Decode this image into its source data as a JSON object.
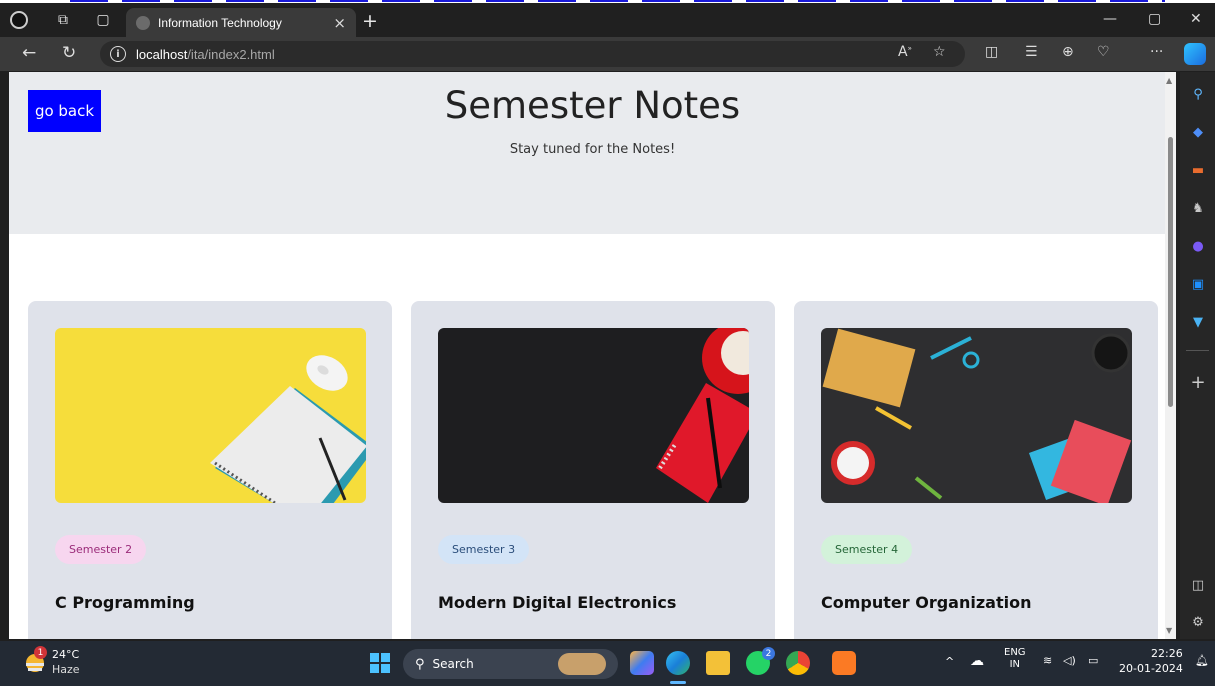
{
  "browser": {
    "tab_title": "Information Technology",
    "new_tab": "+",
    "close_tab": "×",
    "url_host": "localhost",
    "url_path": "/ita/index2.html",
    "url_info": "i"
  },
  "page": {
    "back_button": "go back",
    "title": "Semester Notes",
    "subtitle": "Stay tuned for the Notes!",
    "cards": [
      {
        "badge": "Semester 2",
        "title": "C Programming",
        "badge_bg": "#f7d6ef",
        "badge_fg": "#9b2c7a"
      },
      {
        "badge": "Semester 3",
        "title": "Modern Digital Electronics",
        "badge_bg": "#d3e4f7",
        "badge_fg": "#2a4d7a"
      },
      {
        "badge": "Semester 4",
        "title": "Computer Organization",
        "badge_bg": "#d3f2da",
        "badge_fg": "#256638"
      }
    ]
  },
  "taskbar": {
    "weather_temp": "24°C",
    "weather_cond": "Haze",
    "weather_alert": "1",
    "search_label": "Search",
    "lang_top": "ENG",
    "lang_bottom": "IN",
    "time": "22:26",
    "date": "20-01-2024",
    "whatsapp_badge": "2"
  },
  "colors": {
    "accent_button": "#0000ff",
    "hero_bg": "#e9ebee",
    "card_bg": "#dfe2ea"
  }
}
